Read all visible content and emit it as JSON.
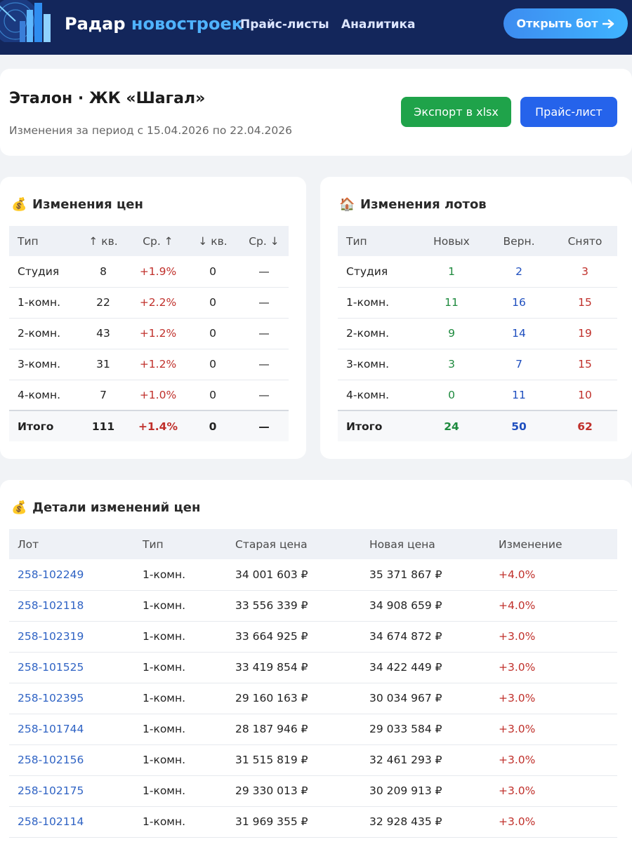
{
  "header": {
    "brand_part1": "Радар",
    "brand_part2": "новостроек",
    "nav": [
      "Прайс-листы",
      "Аналитика"
    ],
    "bot_button": "Открыть бот",
    "bot_icon": "arrow-right-icon"
  },
  "title": {
    "heading": "Эталон · ЖК «Шагал»",
    "period": "Изменения за период с 15.04.2026 по 22.04.2026",
    "export_button": "Экспорт в xlsx",
    "price_button": "Прайс-лист"
  },
  "price_changes": {
    "title": "Изменения цен",
    "icon": "money-bag-icon",
    "columns": [
      "Тип",
      "↑ кв.",
      "Ср. ↑",
      "↓ кв.",
      "Ср. ↓"
    ],
    "rows": [
      [
        "Студия",
        "8",
        "+1.9%",
        "0",
        "—"
      ],
      [
        "1-комн.",
        "22",
        "+2.2%",
        "0",
        "—"
      ],
      [
        "2-комн.",
        "43",
        "+1.2%",
        "0",
        "—"
      ],
      [
        "3-комн.",
        "31",
        "+1.2%",
        "0",
        "—"
      ],
      [
        "4-комн.",
        "7",
        "+1.0%",
        "0",
        "—"
      ]
    ],
    "total": [
      "Итого",
      "111",
      "+1.4%",
      "0",
      "—"
    ]
  },
  "lot_changes": {
    "title": "Изменения лотов",
    "icon": "house-icon",
    "columns": [
      "Тип",
      "Новых",
      "Верн.",
      "Снято"
    ],
    "rows": [
      [
        "Студия",
        "1",
        "2",
        "3"
      ],
      [
        "1-комн.",
        "11",
        "16",
        "15"
      ],
      [
        "2-комн.",
        "9",
        "14",
        "19"
      ],
      [
        "3-комн.",
        "3",
        "7",
        "15"
      ],
      [
        "4-комн.",
        "0",
        "11",
        "10"
      ]
    ],
    "total": [
      "Итого",
      "24",
      "50",
      "62"
    ]
  },
  "details": {
    "title": "Детали изменений цен",
    "icon": "money-bag-icon",
    "columns": [
      "Лот",
      "Тип",
      "Старая цена",
      "Новая цена",
      "Изменение"
    ],
    "rows": [
      [
        "258-102249",
        "1-комн.",
        "34 001 603 ₽",
        "35 371 867 ₽",
        "+4.0%"
      ],
      [
        "258-102118",
        "1-комн.",
        "33 556 339 ₽",
        "34 908 659 ₽",
        "+4.0%"
      ],
      [
        "258-102319",
        "1-комн.",
        "33 664 925 ₽",
        "34 674 872 ₽",
        "+3.0%"
      ],
      [
        "258-101525",
        "1-комн.",
        "33 419 854 ₽",
        "34 422 449 ₽",
        "+3.0%"
      ],
      [
        "258-102395",
        "1-комн.",
        "29 160 163 ₽",
        "30 034 967 ₽",
        "+3.0%"
      ],
      [
        "258-101744",
        "1-комн.",
        "28 187 946 ₽",
        "29 033 584 ₽",
        "+3.0%"
      ],
      [
        "258-102156",
        "1-комн.",
        "31 515 819 ₽",
        "32 461 293 ₽",
        "+3.0%"
      ],
      [
        "258-102175",
        "1-комн.",
        "29 330 013 ₽",
        "30 209 913 ₽",
        "+3.0%"
      ],
      [
        "258-102114",
        "1-комн.",
        "31 969 355 ₽",
        "32 928 435 ₽",
        "+3.0%"
      ]
    ]
  }
}
